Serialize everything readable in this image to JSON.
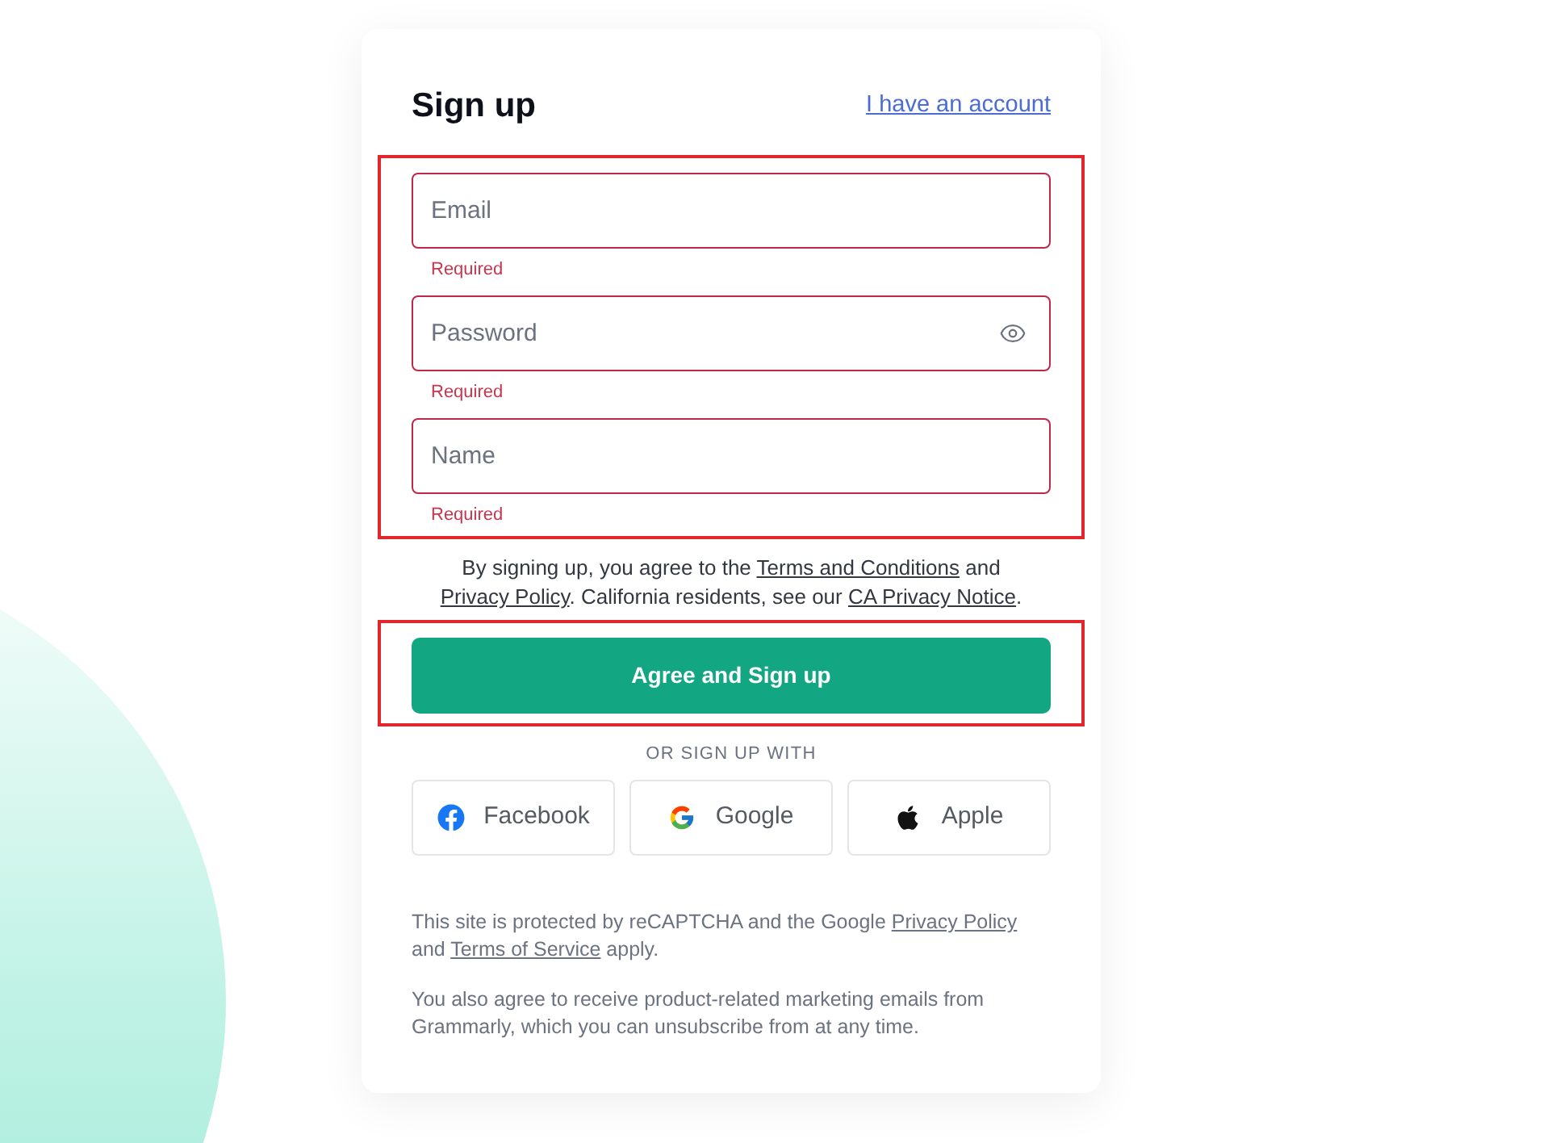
{
  "header": {
    "title": "Sign up",
    "link": "I have an account"
  },
  "form": {
    "highlighted": true,
    "fields": [
      {
        "kind": "plain",
        "placeholder": "Email",
        "invalid": true,
        "error": "Required"
      },
      {
        "kind": "password",
        "placeholder": "Password",
        "invalid": true,
        "error": "Required"
      },
      {
        "kind": "plain",
        "placeholder": "Name",
        "invalid": true,
        "error": "Required"
      }
    ]
  },
  "agreement": [
    {
      "kind": "text",
      "text": "By signing up, you agree to the "
    },
    {
      "kind": "link",
      "text": "Terms and Conditions"
    },
    {
      "kind": "text",
      "text": " and "
    },
    {
      "kind": "link",
      "text": "Privacy Policy"
    },
    {
      "kind": "text",
      "text": ". California residents, see our "
    },
    {
      "kind": "link",
      "text": "CA Privacy Notice"
    },
    {
      "kind": "text",
      "text": "."
    }
  ],
  "submit": {
    "highlighted": true,
    "label": "Agree and Sign up"
  },
  "social": {
    "label": "OR SIGN UP WITH",
    "buttons": [
      {
        "kind": "facebook",
        "label": "Facebook"
      },
      {
        "kind": "google",
        "label": "Google"
      },
      {
        "kind": "apple",
        "label": "Apple"
      }
    ]
  },
  "notices": [
    [
      {
        "kind": "text",
        "text": "This site is protected by reCAPTCHA and the Google "
      },
      {
        "kind": "link",
        "text": "Privacy Policy"
      },
      {
        "kind": "text",
        "text": " and "
      },
      {
        "kind": "link",
        "text": "Terms of Service"
      },
      {
        "kind": "text",
        "text": " apply."
      }
    ],
    [
      {
        "kind": "text",
        "text": "You also agree to receive product-related marketing emails from Grammarly, which you can unsubscribe from at any time."
      }
    ]
  ]
}
